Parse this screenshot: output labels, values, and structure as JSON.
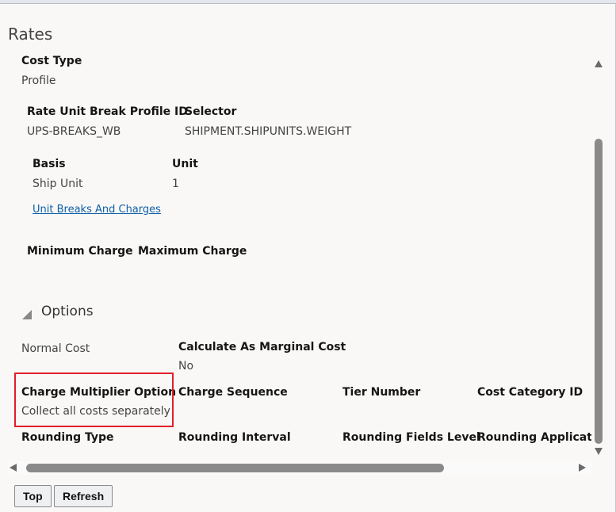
{
  "section_title": "Rates",
  "cost_type": {
    "label": "Cost Type",
    "value": "Profile"
  },
  "rate_unit_break_profile": {
    "label": "Rate Unit Break Profile ID",
    "value": "UPS-BREAKS_WB"
  },
  "selector": {
    "label": "Selector",
    "value": "SHIPMENT.SHIPUNITS.WEIGHT"
  },
  "basis": {
    "label": "Basis",
    "value": "Ship Unit"
  },
  "unit": {
    "label": "Unit",
    "value": "1"
  },
  "unit_breaks_link": "Unit Breaks And Charges",
  "minimum_charge": {
    "label": "Minimum Charge"
  },
  "maximum_charge": {
    "label": "Maximum Charge"
  },
  "options": {
    "title": "Options",
    "normal_cost": "Normal Cost",
    "calculate_marginal": {
      "label": "Calculate As Marginal Cost",
      "value": "No"
    },
    "charge_multiplier": {
      "label": "Charge Multiplier Option",
      "value": "Collect all costs separately"
    },
    "charge_sequence": {
      "label": "Charge Sequence"
    },
    "tier_number": {
      "label": "Tier Number"
    },
    "cost_category": {
      "label": "Cost Category ID"
    },
    "rounding_type": {
      "label": "Rounding Type"
    },
    "rounding_interval": {
      "label": "Rounding Interval"
    },
    "rounding_fields_level": {
      "label": "Rounding Fields Level"
    },
    "rounding_application": {
      "label": "Rounding Applicatio"
    }
  },
  "buttons": {
    "top": "Top",
    "refresh": "Refresh"
  },
  "colors": {
    "highlight": "#e0202a",
    "link": "#0f5fa8"
  }
}
